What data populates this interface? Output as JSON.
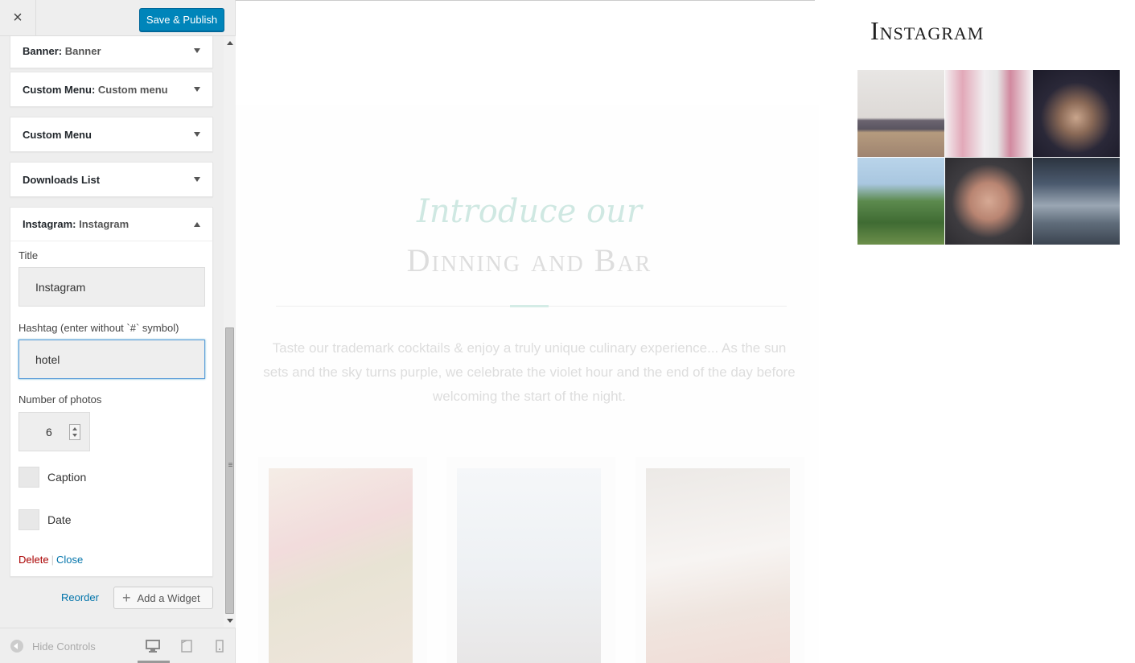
{
  "sidebar": {
    "close_label": "×",
    "publish_label": "Save & Publish",
    "widgets": [
      {
        "name": "Banner:",
        "subtitle": "Banner"
      },
      {
        "name": "Custom Menu:",
        "subtitle": "Custom menu"
      },
      {
        "name": "Custom Menu",
        "subtitle": ""
      },
      {
        "name": "Downloads List",
        "subtitle": ""
      },
      {
        "name": "Instagram:",
        "subtitle": "Instagram"
      }
    ],
    "instagram_form": {
      "title_label": "Title",
      "title_value": "Instagram",
      "hashtag_label": "Hashtag (enter without `#` symbol)",
      "hashtag_value": "hotel",
      "photos_label": "Number of photos",
      "photos_value": "6",
      "caption_label": "Caption",
      "date_label": "Date",
      "delete_label": "Delete",
      "separator": "|",
      "close_label": "Close"
    },
    "reorder_label": "Reorder",
    "add_widget_label": "Add a Widget",
    "footer": {
      "hide_controls_label": "Hide Controls",
      "devices": [
        "desktop",
        "tablet",
        "mobile"
      ],
      "active_device": "desktop"
    }
  },
  "preview": {
    "intro_script": "Introduce our",
    "intro_heading": "Dinning and Bar",
    "intro_text": "Taste our trademark cocktails & enjoy a truly unique culinary experience... As the sun sets and the sky turns purple, we celebrate the violet hour and the end of the day before welcoming the start of the night.",
    "instagram_title": "Instagram",
    "instagram_photo_count": 6
  },
  "colors": {
    "primary_button": "#0085ba",
    "link": "#0073aa",
    "delete": "#a00",
    "accent": "#d4ece6"
  }
}
